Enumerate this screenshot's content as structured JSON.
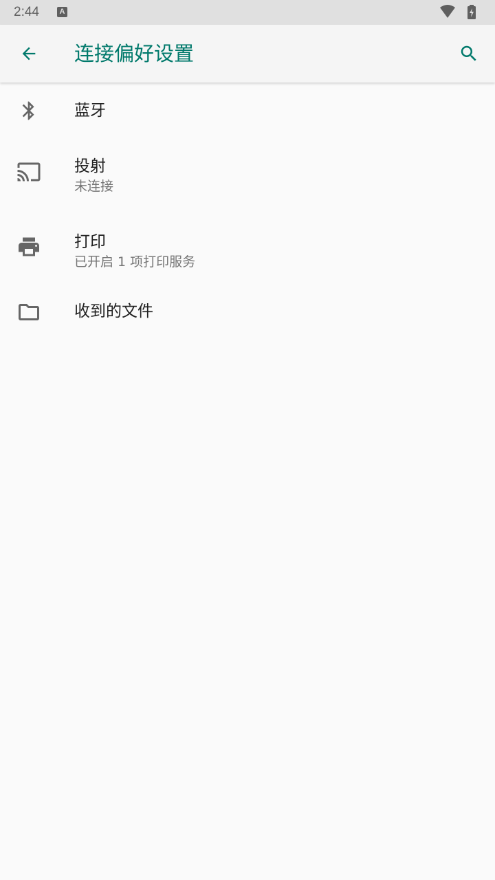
{
  "status_bar": {
    "time": "2:44",
    "notification_icon": "a-icon",
    "notification_letter": "A",
    "wifi_icon": "wifi-icon",
    "battery_icon": "battery-charging-icon"
  },
  "app_bar": {
    "title": "连接偏好设置",
    "back_icon": "arrow-back-icon",
    "search_icon": "search-icon",
    "accent_color": "#00796b"
  },
  "items": [
    {
      "icon": "bluetooth-icon",
      "title": "蓝牙"
    },
    {
      "icon": "cast-icon",
      "title": "投射",
      "subtitle": "未连接"
    },
    {
      "icon": "printer-icon",
      "title": "打印",
      "subtitle": "已开启 1 项打印服务"
    },
    {
      "icon": "folder-icon",
      "title": "收到的文件"
    }
  ]
}
